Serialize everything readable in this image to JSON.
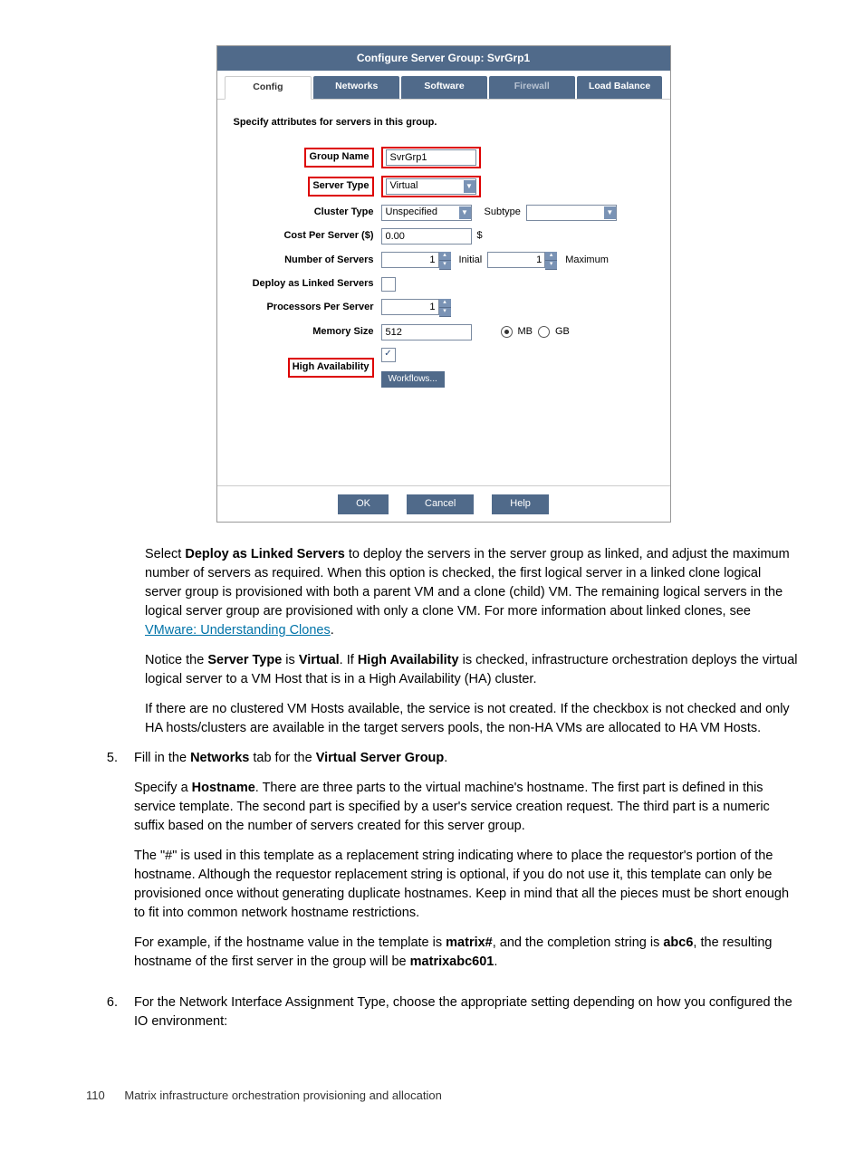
{
  "dialog": {
    "title": "Configure Server Group: SvrGrp1",
    "tabs": [
      "Config",
      "Networks",
      "Software",
      "Firewall",
      "Load Balance"
    ],
    "heading": "Specify attributes for servers in this group.",
    "labels": {
      "group_name": "Group Name",
      "server_type": "Server Type",
      "cluster_type": "Cluster Type",
      "subtype": "Subtype",
      "cost_per_server": "Cost Per Server ($)",
      "dollar_sign": "$",
      "number_of_servers": "Number of Servers",
      "initial": "Initial",
      "maximum": "Maximum",
      "deploy_linked": "Deploy as Linked Servers",
      "processors": "Processors Per Server",
      "memory_size": "Memory Size",
      "mb": "MB",
      "gb": "GB",
      "high_availability": "High Availability",
      "workflows": "Workflows..."
    },
    "values": {
      "group_name": "SvrGrp1",
      "server_type": "Virtual",
      "cluster_type": "Unspecified",
      "subtype": "",
      "cost": "0.00",
      "servers_initial": "1",
      "servers_max": "1",
      "processors": "1",
      "memory": "512"
    },
    "buttons": {
      "ok": "OK",
      "cancel": "Cancel",
      "help": "Help"
    }
  },
  "doc": {
    "p1a": "Select ",
    "p1b": "Deploy as Linked Servers",
    "p1c": " to deploy the servers in the server group as linked, and adjust the maximum number of servers as required. When this option is checked, the first logical server in a linked clone logical server group is provisioned with both a parent VM and a clone (child) VM. The remaining logical servers in the logical server group are provisioned with only a clone VM. For more information about linked clones, see ",
    "p1link": "VMware: Understanding Clones",
    "p1d": ".",
    "p2a": "Notice the ",
    "p2b": "Server Type",
    "p2c": " is ",
    "p2d": "Virtual",
    "p2e": ". If ",
    "p2f": "High Availability",
    "p2g": " is checked, infrastructure orchestration deploys the virtual logical server to a VM Host that is in a High Availability (HA) cluster.",
    "p3": "If there are no clustered VM Hosts available, the service is not created. If the checkbox is not checked and only HA hosts/clusters are available in the target servers pools, the non-HA VMs are allocated to HA VM Hosts.",
    "li5num": "5.",
    "li5a": "Fill in the ",
    "li5b": "Networks",
    "li5c": " tab for the ",
    "li5d": "Virtual Server Group",
    "li5e": ".",
    "li5p1a": "Specify a ",
    "li5p1b": "Hostname",
    "li5p1c": ". There are three parts to the virtual machine's hostname. The first part is defined in this service template. The second part is specified by a user's service creation request. The third part is a numeric suffix based on the number of servers created for this server group.",
    "li5p2": "The \"#\" is used in this template as a replacement string indicating where to place the requestor's portion of the hostname. Although the requestor replacement string is optional, if you do not use it, this template can only be provisioned once without generating duplicate hostnames. Keep in mind that all the pieces must be short enough to fit into common network hostname restrictions.",
    "li5p3a": "For example, if the hostname value in the template is ",
    "li5p3b": "matrix#",
    "li5p3c": ", and the completion string is ",
    "li5p3d": "abc6",
    "li5p3e": ", the resulting hostname of the first server in the group will be ",
    "li5p3f": "matrixabc601",
    "li5p3g": ".",
    "li6num": "6.",
    "li6": "For the Network Interface Assignment Type, choose the appropriate setting depending on how you configured the IO environment:"
  },
  "footer": {
    "page": "110",
    "text": "Matrix infrastructure orchestration provisioning and allocation"
  }
}
